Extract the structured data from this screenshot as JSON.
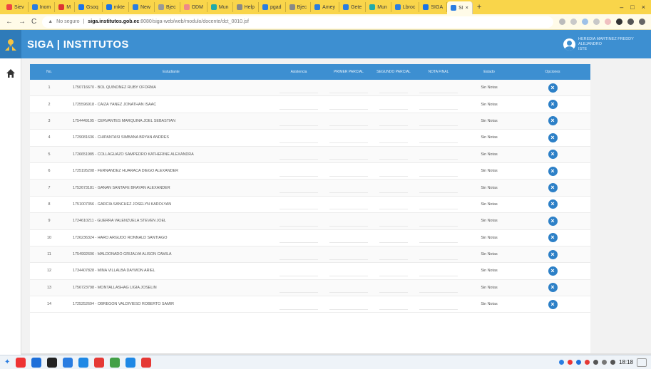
{
  "browser": {
    "tabs": [
      "Siev",
      "Inom",
      "M",
      "Gsoq",
      "mkte",
      "New",
      "Bjec",
      "ODM",
      "Mun",
      "Help",
      "pgad",
      "Bjec",
      "Amey",
      "Gete",
      "Mun",
      "Lbroc",
      "SIGA",
      "SI"
    ],
    "tab_colors": [
      "#e44",
      "#2a7de1",
      "#d33",
      "#1a73e8",
      "#1a73e8",
      "#2a7de1",
      "#999",
      "#e88",
      "#2aa",
      "#888",
      "#2a7de1",
      "#888",
      "#2a7de1",
      "#2a7de1",
      "#2aa",
      "#2a7de1",
      "#1a73e8",
      "#2a7de1"
    ],
    "active_tab_index": 17,
    "address": {
      "security": "No seguro",
      "domain": "siga.institutos.gob.ec",
      "path": ":8080/siga-web/web/modulo/docente/dct_0010.jsf"
    }
  },
  "app": {
    "title": "SIGA | INSTITUTOS",
    "user": {
      "line1": "HEREDIA MARTINEZ FREDDY",
      "line2": "ALEJANDRO",
      "line3": "ISTE"
    },
    "accent": "#3d8fd1"
  },
  "table": {
    "headers": [
      "No.",
      "Estudiante",
      "Asistencia",
      "PRIMER PARCIAL",
      "SEGUNDO PARCIAL",
      "NOTA FINAL",
      "Estado",
      "Opciones"
    ],
    "rows": [
      {
        "num": "1",
        "name": "1750716670 - BOL QUIÑONEZ RUBY OFORMA",
        "status": "Sin Notas"
      },
      {
        "num": "2",
        "name": "1725596918 - CAIZA YANEZ JONATHAN ISAAC",
        "status": "Sin Notas"
      },
      {
        "num": "3",
        "name": "1754449195 - CERVANTES MARQUINA JOEL SEBASTIAN",
        "status": "Sin Notas"
      },
      {
        "num": "4",
        "name": "1729081636 - CHIPANTASI SIMBAÑA BRYAN ANDRES",
        "status": "Sin Notas"
      },
      {
        "num": "5",
        "name": "1726651985 - COLLAGUAZO SAMPEDRO KATHERINE ALEXANDRA",
        "status": "Sin Notas"
      },
      {
        "num": "6",
        "name": "1725195208 - FERNANDEZ HUARACA DIEGO ALEXANDER",
        "status": "Sin Notas"
      },
      {
        "num": "7",
        "name": "1752673181 - GANAN SANTAFE BRAYAN ALEXANDER",
        "status": "Sin Notas"
      },
      {
        "num": "8",
        "name": "1751007356 - GARCIA SANCHEZ JOSELYN KAROLYAN",
        "status": "Sin Notas"
      },
      {
        "num": "9",
        "name": "1724610211 - GUERRA VALENZUELA STEVEN JOEL",
        "status": "Sin Notas"
      },
      {
        "num": "10",
        "name": "1726236324 - HARO ARGUDO RONNALD SANTIAGO",
        "status": "Sin Notas"
      },
      {
        "num": "11",
        "name": "1754992606 - MALDONADO GRIJALVA ALISON CAMILA",
        "status": "Sin Notas"
      },
      {
        "num": "12",
        "name": "1734407828 - MINA VILLALBA DAYMON ARIEL",
        "status": "Sin Notas"
      },
      {
        "num": "13",
        "name": "1756723798 - MONTALLASHAG LIGIA JOSELIN",
        "status": "Sin Notas"
      },
      {
        "num": "14",
        "name": "1725252694 - OBREGON VALDIVIESO ROBERTO SAMIR",
        "status": "Sin Notas"
      }
    ]
  },
  "taskbar": {
    "clock_time": "18:18",
    "app_colors": [
      "#e33",
      "#1e6fd9",
      "#222",
      "#2a7de1",
      "#1e88e5",
      "#e53935",
      "#43a047",
      "#1e88e5",
      "#e53935"
    ]
  }
}
